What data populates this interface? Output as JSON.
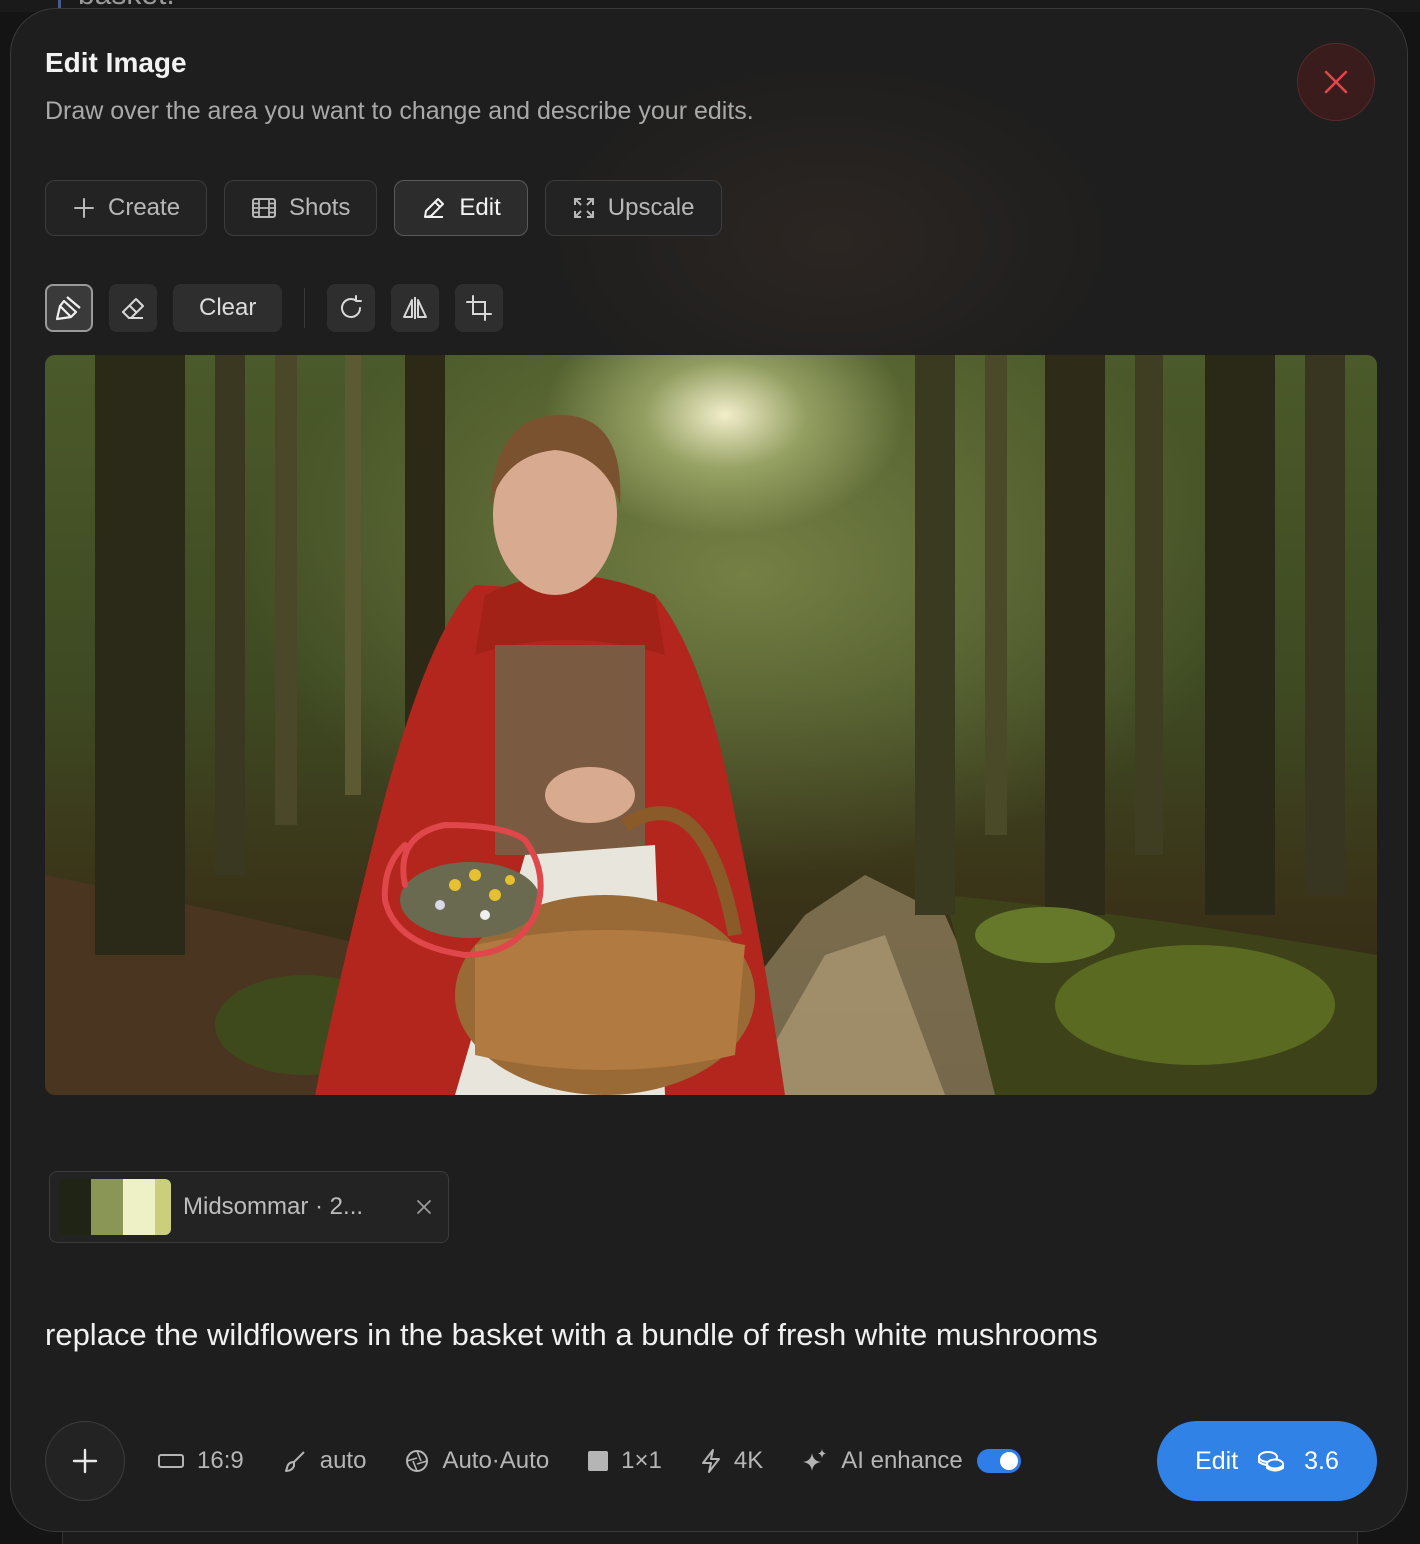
{
  "modal": {
    "title": "Edit Image",
    "subtitle": "Draw over the area you want to change and describe your edits."
  },
  "background_peek": {
    "text": "basket."
  },
  "tabs": [
    {
      "label": "Create",
      "icon": "plus-icon",
      "active": false
    },
    {
      "label": "Shots",
      "icon": "film-icon",
      "active": false
    },
    {
      "label": "Edit",
      "icon": "pencil-icon",
      "active": true
    },
    {
      "label": "Upscale",
      "icon": "expand-icon",
      "active": false
    }
  ],
  "toolbar": {
    "clear_label": "Clear",
    "tools": [
      "brush-icon",
      "eraser-icon",
      "rotate-icon",
      "flip-icon",
      "crop-icon"
    ]
  },
  "canvas": {
    "description_icon": "image-canvas",
    "mask_color": "#e0474a"
  },
  "style_chip": {
    "label": "Midsommar · 2...",
    "swatches": [
      "#1f2415",
      "#8a9656",
      "#eef0c6",
      "#c9cf7a"
    ]
  },
  "prompt": {
    "text": "replace the wildflowers in the basket with a bundle of fresh white mushrooms"
  },
  "options": {
    "aspect_ratio": "16:9",
    "style": "auto",
    "model": "Auto·Auto",
    "grid": "1×1",
    "resolution": "4K",
    "enhance_label": "AI enhance",
    "enhance_on": true
  },
  "submit": {
    "label": "Edit",
    "cost": "3.6"
  },
  "colors": {
    "accent": "#3182e6",
    "close_red": "#e0474a",
    "panel": "#1e1e1e"
  }
}
